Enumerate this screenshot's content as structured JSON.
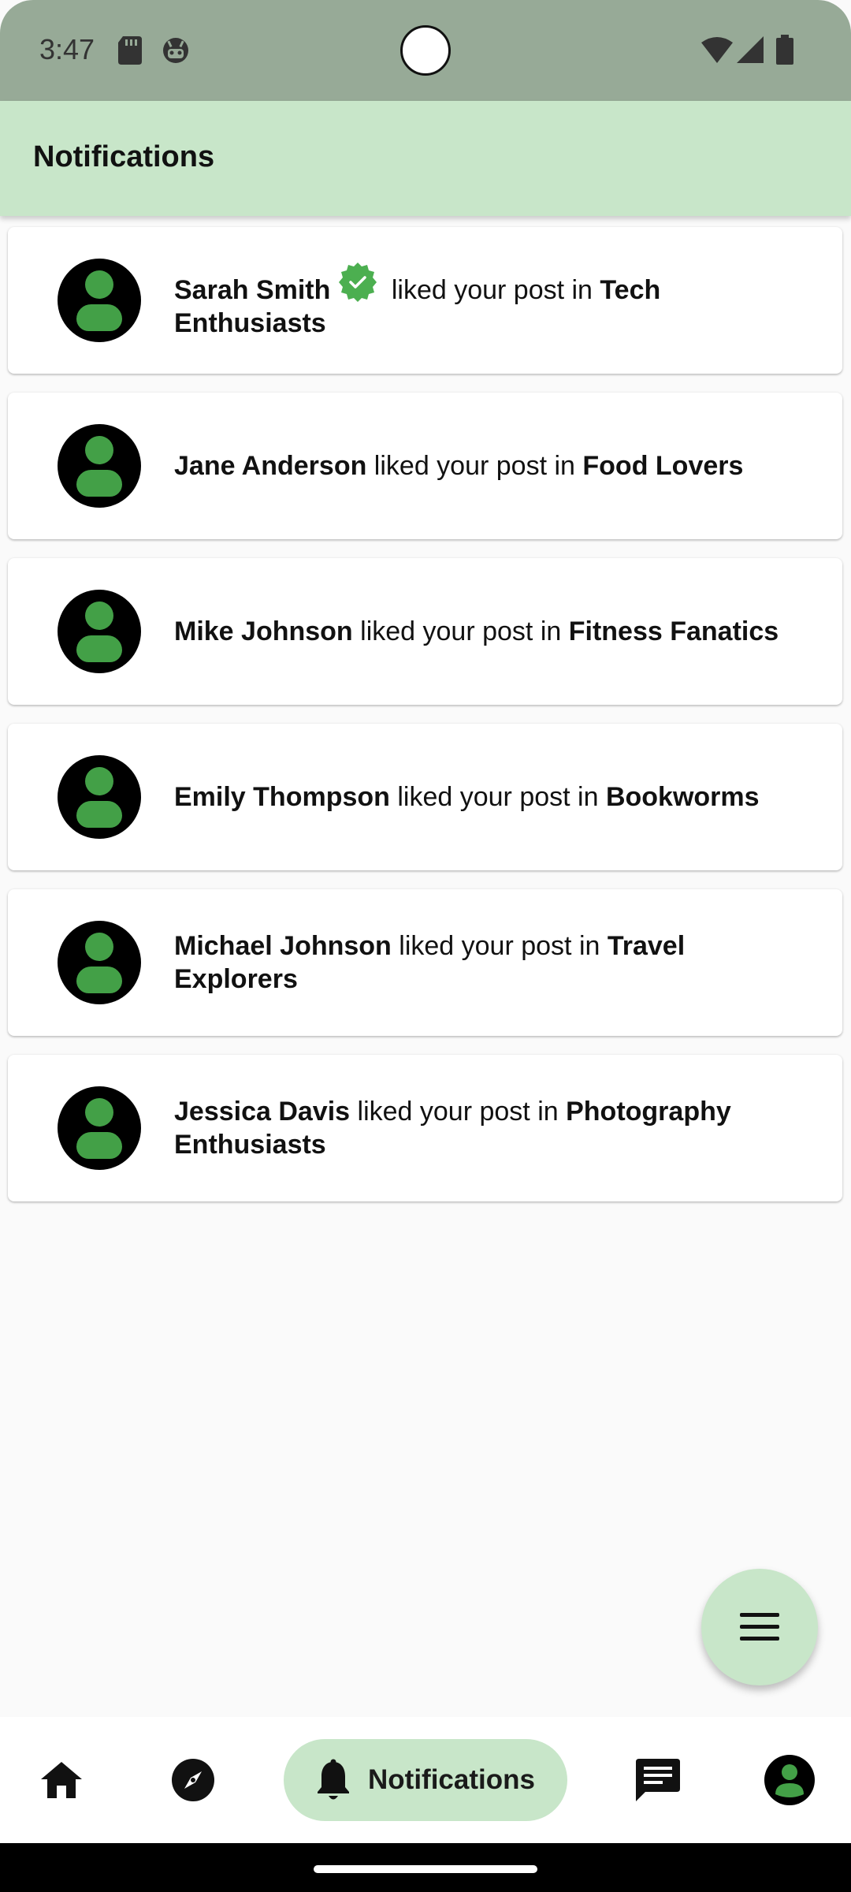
{
  "status_bar": {
    "time": "3:47",
    "left_icons": [
      "sd-card-icon",
      "android-debug-icon"
    ],
    "right_icons": [
      "wifi-icon",
      "cellular-signal-icon",
      "battery-icon"
    ]
  },
  "app_bar": {
    "title": "Notifications"
  },
  "notifications": [
    {
      "name": "Sarah Smith",
      "verified": true,
      "action": " liked your post in ",
      "group": "Tech Enthusiasts"
    },
    {
      "name": "Jane Anderson",
      "verified": false,
      "action": " liked your post in ",
      "group": "Food Lovers"
    },
    {
      "name": "Mike Johnson",
      "verified": false,
      "action": " liked your post in ",
      "group": "Fitness Fanatics"
    },
    {
      "name": "Emily Thompson",
      "verified": false,
      "action": " liked your post in ",
      "group": "Bookworms"
    },
    {
      "name": "Michael Johnson",
      "verified": false,
      "action": " liked your post in ",
      "group": "Travel Explorers"
    },
    {
      "name": "Jessica Davis",
      "verified": false,
      "action": " liked your post in ",
      "group": "Photography Enthusiasts"
    }
  ],
  "fab": {
    "icon": "menu-icon"
  },
  "bottom_nav": {
    "items": [
      {
        "icon": "home-icon",
        "selected": false
      },
      {
        "icon": "explore-compass-icon",
        "selected": false
      },
      {
        "icon": "bell-icon",
        "label": "Notifications",
        "selected": true
      },
      {
        "icon": "chat-icon",
        "selected": false
      },
      {
        "icon": "profile-avatar-icon",
        "selected": false
      }
    ]
  },
  "colors": {
    "status_bar": "#97aa97",
    "app_bar": "#c8e6c9",
    "accent_green": "#43a047",
    "verified_badge": "#4caf50",
    "background": "#fafafa"
  }
}
